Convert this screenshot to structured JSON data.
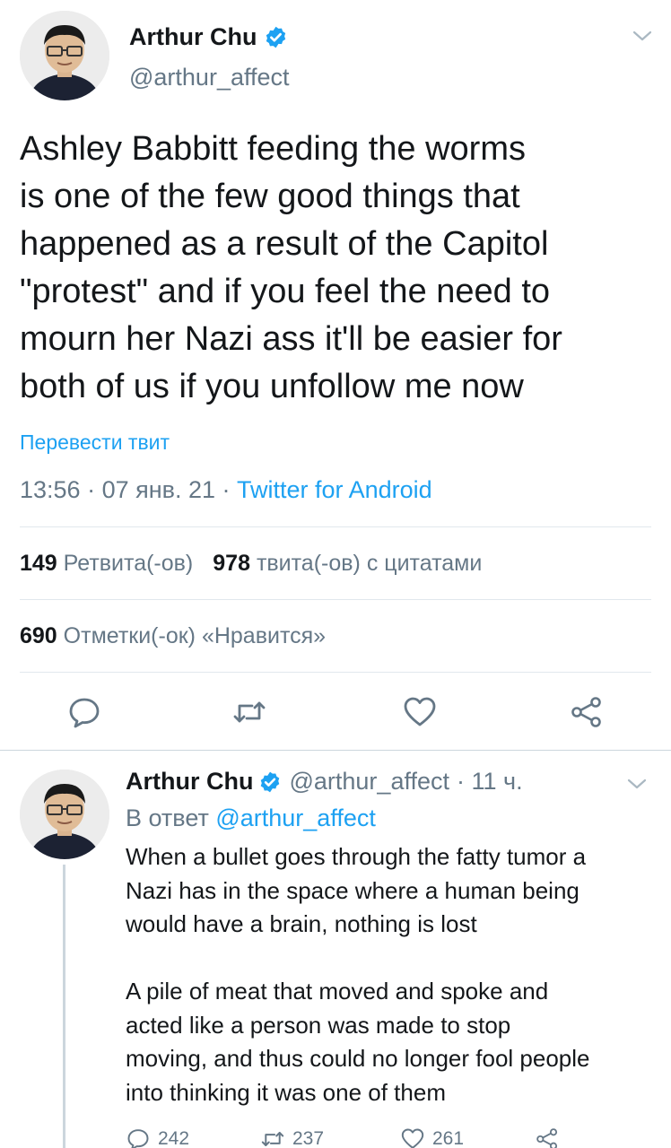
{
  "main_tweet": {
    "display_name": "Arthur Chu",
    "handle": "@arthur_affect",
    "text": "Ashley Babbitt feeding the worms\nis one of the few good things that\nhappened as a result of the Capitol\n\"protest\" and if you feel the need to\nmourn her Nazi ass it'll be easier for\nboth of us if you unfollow me now",
    "translate_label": "Перевести твит",
    "time": "13:56",
    "date": "07 янв. 21",
    "separator": " · ",
    "source": "Twitter for Android",
    "retweets_count": "149",
    "retweets_label": "Ретвита(-ов)",
    "quotes_count": "978",
    "quotes_label": "твита(-ов) с цитатами",
    "likes_count": "690",
    "likes_label": "Отметки(-ок) «Нравится»"
  },
  "reply_tweet": {
    "display_name": "Arthur Chu",
    "handle": "@arthur_affect",
    "age": "· 11 ч.",
    "reply_prefix": "В ответ",
    "reply_mention": "@arthur_affect",
    "text": "When a bullet goes through the fatty tumor a\nNazi has in the space where a human being\nwould have a brain, nothing is lost\n\nA pile of meat that moved and spoke and\nacted like a person was made to stop\nmoving, and thus could no longer fool people\ninto thinking it was one of them",
    "reply_count": "242",
    "retweet_count": "237",
    "like_count": "261"
  },
  "colors": {
    "accent": "#1da1f2",
    "secondary_text": "#657786",
    "primary_text": "#14171a",
    "divider": "#e1e8ed"
  },
  "icons": {
    "verified": "verified-badge-icon",
    "caret": "chevron-down-icon",
    "reply": "reply-icon",
    "retweet": "retweet-icon",
    "like": "heart-icon",
    "share": "share-icon"
  }
}
